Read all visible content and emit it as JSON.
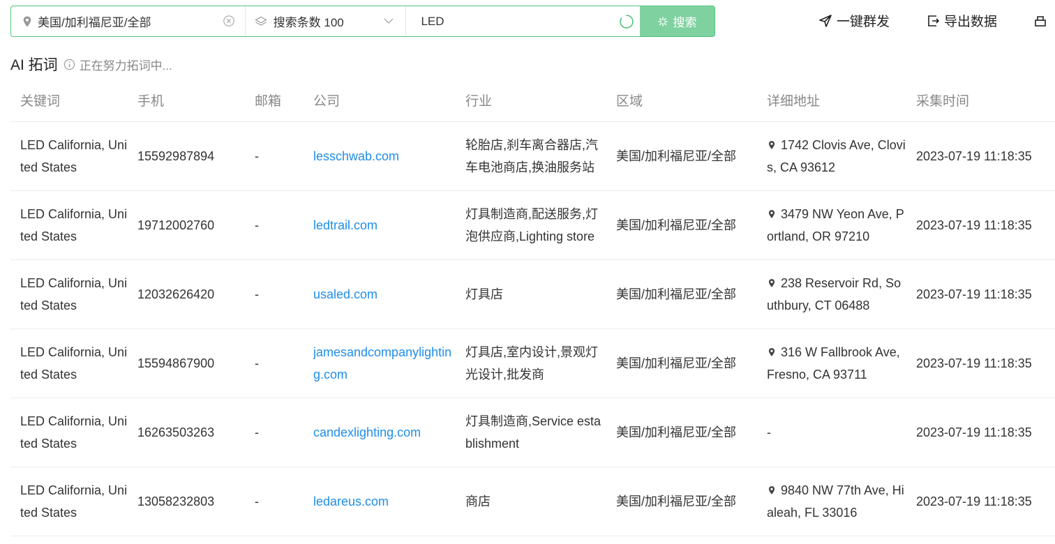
{
  "search": {
    "region": "美国/加利福尼亚/全部",
    "count_label": "搜索条数 100",
    "keyword": "LED",
    "button": "搜索"
  },
  "actions": {
    "broadcast": "一键群发",
    "export": "导出数据"
  },
  "ai": {
    "title": "AI 拓词",
    "status": "正在努力拓词中..."
  },
  "table": {
    "headers": [
      "关键词",
      "手机",
      "邮箱",
      "公司",
      "行业",
      "区域",
      "详细地址",
      "采集时间"
    ],
    "rows": [
      {
        "keyword": "LED California, United States",
        "phone": "15592987894",
        "email": "-",
        "company": "lesschwab.com",
        "industry": "轮胎店,刹车离合器店,汽车电池商店,换油服务站",
        "region": "美国/加利福尼亚/全部",
        "address": "1742 Clovis Ave, Clovis, CA 93612",
        "time": "2023-07-19 11:18:35"
      },
      {
        "keyword": "LED California, United States",
        "phone": "19712002760",
        "email": "-",
        "company": "ledtrail.com",
        "industry": "灯具制造商,配送服务,灯泡供应商,Lighting store",
        "region": "美国/加利福尼亚/全部",
        "address": "3479 NW Yeon Ave, Portland, OR 97210",
        "time": "2023-07-19 11:18:35"
      },
      {
        "keyword": "LED California, United States",
        "phone": "12032626420",
        "email": "-",
        "company": "usaled.com",
        "industry": "灯具店",
        "region": "美国/加利福尼亚/全部",
        "address": "238 Reservoir Rd, Southbury, CT 06488",
        "time": "2023-07-19 11:18:35"
      },
      {
        "keyword": "LED California, United States",
        "phone": "15594867900",
        "email": "-",
        "company": "jamesandcompanylighting.com",
        "industry": "灯具店,室内设计,景观灯光设计,批发商",
        "region": "美国/加利福尼亚/全部",
        "address": "316 W Fallbrook Ave, Fresno, CA 93711",
        "time": "2023-07-19 11:18:35"
      },
      {
        "keyword": "LED California, United States",
        "phone": "16263503263",
        "email": "-",
        "company": "candexlighting.com",
        "industry": "灯具制造商,Service establishment",
        "region": "美国/加利福尼亚/全部",
        "address": "-",
        "time": "2023-07-19 11:18:35"
      },
      {
        "keyword": "LED California, United States",
        "phone": "13058232803",
        "email": "-",
        "company": "ledareus.com",
        "industry": "商店",
        "region": "美国/加利福尼亚/全部",
        "address": "9840 NW 77th Ave, Hialeah, FL 33016",
        "time": "2023-07-19 11:18:35"
      }
    ]
  },
  "colors": {
    "accent": "#52c27a",
    "button": "#7fd2a0",
    "link": "#1f8ee8"
  }
}
